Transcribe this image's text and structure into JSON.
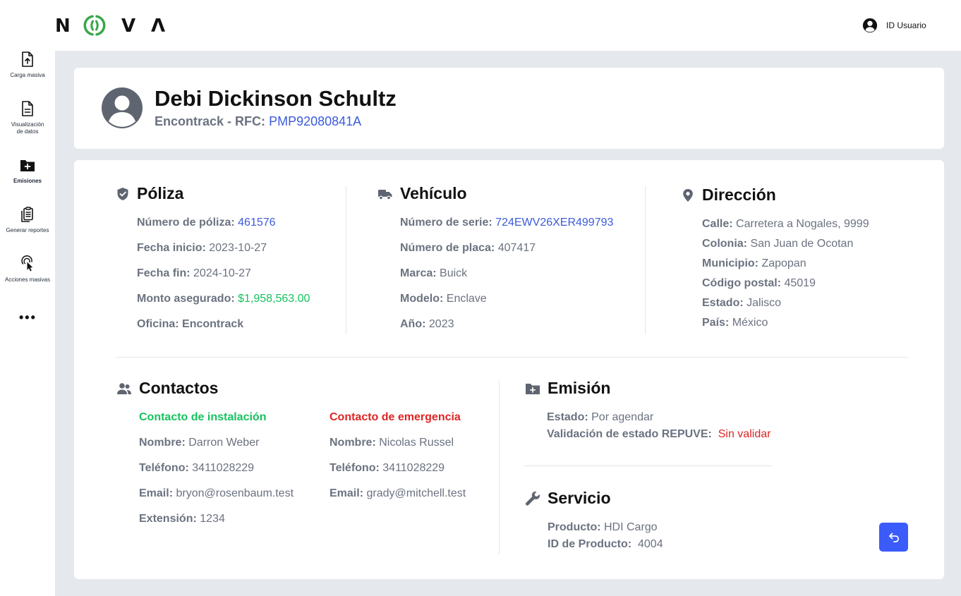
{
  "brand": {
    "letters": [
      "N",
      "V",
      "Λ"
    ],
    "accent": "#3aa64a"
  },
  "user": {
    "label": "ID Usuario"
  },
  "sidebar": {
    "items": [
      {
        "label": "Carga masiva",
        "icon": "upload-file-icon"
      },
      {
        "label": "Visualización de datos",
        "icon": "document-icon"
      },
      {
        "label": "Emisiones",
        "icon": "folder-plus-icon",
        "active": true
      },
      {
        "label": "Generar reportes",
        "icon": "clipboard-copy-icon"
      },
      {
        "label": "Acciones masivas",
        "icon": "pointer-click-icon"
      }
    ],
    "more": "•••"
  },
  "profile": {
    "name": "Debi Dickinson Schultz",
    "company": "Encontrack",
    "separator": " - ",
    "rfc_label": "RFC:",
    "rfc_value": "PMP92080841A"
  },
  "poliza": {
    "title": "Póliza",
    "fields": [
      {
        "label": "Número de póliza:",
        "value": "461576"
      },
      {
        "label": "Fecha inicio:",
        "value": "2023-10-27"
      },
      {
        "label": "Fecha fin:",
        "value": "2024-10-27"
      },
      {
        "label": "Monto asegurado:",
        "value": "$1,958,563.00"
      },
      {
        "label": "Oficina:",
        "value": "Encontrack"
      }
    ]
  },
  "vehiculo": {
    "title": "Vehículo",
    "fields": [
      {
        "label": "Número de serie:",
        "value": "724EWV26XER499793"
      },
      {
        "label": "Número de placa:",
        "value": "407417"
      },
      {
        "label": "Marca:",
        "value": "Buick"
      },
      {
        "label": "Modelo:",
        "value": "Enclave"
      },
      {
        "label": "Año:",
        "value": "2023"
      }
    ]
  },
  "direccion": {
    "title": "Dirección",
    "fields": [
      {
        "label": "Calle:",
        "value": "Carretera a Nogales, 9999"
      },
      {
        "label": "Colonia:",
        "value": "San Juan de Ocotan"
      },
      {
        "label": "Municipio:",
        "value": "Zapopan"
      },
      {
        "label": "Código postal:",
        "value": "45019"
      },
      {
        "label": "Estado:",
        "value": "Jalisco"
      },
      {
        "label": "País:",
        "value": "México"
      }
    ]
  },
  "contactos": {
    "title": "Contactos",
    "instalacion": {
      "title": "Contacto de instalación",
      "fields": [
        {
          "label": "Nombre:",
          "value": "Darron Weber"
        },
        {
          "label": "Teléfono:",
          "value": "3411028229"
        },
        {
          "label": "Email:",
          "value": "bryon@rosenbaum.test"
        },
        {
          "label": "Extensión:",
          "value": "1234"
        }
      ]
    },
    "emergencia": {
      "title": "Contacto de emergencia",
      "fields": [
        {
          "label": "Nombre:",
          "value": "Nicolas Russel"
        },
        {
          "label": "Teléfono:",
          "value": "3411028229"
        },
        {
          "label": "Email:",
          "value": "grady@mitchell.test"
        }
      ]
    }
  },
  "emision": {
    "title": "Emisión",
    "fields": [
      {
        "label": "Estado:",
        "value": "Por agendar"
      },
      {
        "label": "Validación de estado REPUVE:",
        "value": "Sin validar"
      }
    ]
  },
  "servicio": {
    "title": "Servicio",
    "fields": [
      {
        "label": "Producto:",
        "value": "HDI Cargo"
      },
      {
        "label": "ID de Producto:",
        "value": "4004"
      }
    ]
  },
  "colors": {
    "link_blue": "#3b5bdb",
    "money_green": "#16c25e",
    "alert_red": "#e02424",
    "button_blue": "#3b5bfb",
    "background": "#e5e8ed"
  }
}
